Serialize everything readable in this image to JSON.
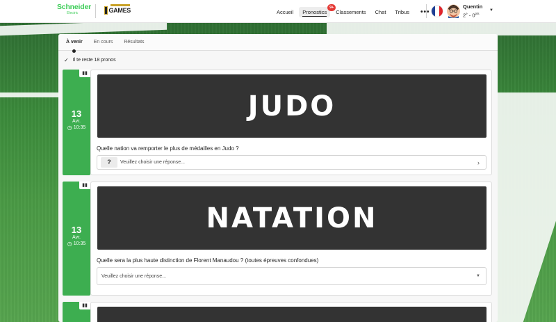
{
  "header": {
    "brand_name": "Schneider",
    "brand_sub": "Electric",
    "games_logo": "GAMES",
    "nav": [
      {
        "label": "Accueil",
        "active": false
      },
      {
        "label": "Pronostics",
        "active": true,
        "badge": "9+"
      },
      {
        "label": "Classements",
        "active": false
      },
      {
        "label": "Chat",
        "active": false
      },
      {
        "label": "Tribus",
        "active": false
      }
    ],
    "more_label": "•••",
    "language_flag": "france-flag",
    "user": {
      "name": "Quentin",
      "rank": "2",
      "rank_suffix": "e",
      "sep": " - ",
      "points": "0",
      "points_suffix": "pts"
    },
    "colors": {
      "brand_green": "#3dcd58",
      "badge_red": "#e53935"
    }
  },
  "tabs": [
    {
      "label": "À venir",
      "active": true
    },
    {
      "label": "En cours",
      "active": false
    },
    {
      "label": "Résultats",
      "active": false
    }
  ],
  "remaining": "Il te reste 18 pronos",
  "cards": [
    {
      "day": "13",
      "month": "Avr.",
      "time": "10:35",
      "banner": "JUDO",
      "question": "Quelle nation va remporter le plus de médailles en Judo ?",
      "answer_badge": "?",
      "placeholder": "Veuillez choisir une réponse...",
      "control": "chevron-right"
    },
    {
      "day": "13",
      "month": "Avr.",
      "time": "10:35",
      "banner": "NATATION",
      "question": "Quelle sera la plus haute distinction de Florent Manaudou ? (toutes épreuves confondues)",
      "placeholder": "Veuillez choisir une réponse...",
      "control": "dropdown"
    }
  ],
  "accent_green": "#3dae50",
  "banner_color": "#333333"
}
